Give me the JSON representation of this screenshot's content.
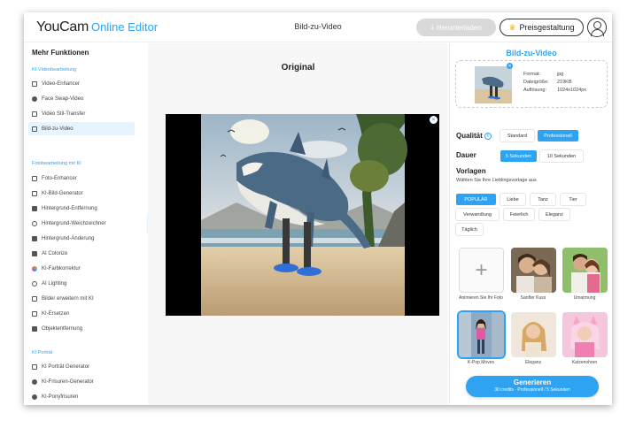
{
  "header": {
    "logo_brand": "YouCam",
    "logo_sub": "Online Editor",
    "page_title": "Bild-zu-Video",
    "download_label": "Herunterladen",
    "pricing_label": "Preisgestaltung"
  },
  "sidebar": {
    "title": "Mehr Funktionen",
    "sections": [
      {
        "label": "KI-Videobearbeitung"
      },
      {
        "label": "Fotobearbeitung mit KI"
      },
      {
        "label": "KI Porträt"
      }
    ],
    "items": [
      {
        "label": "Video-Enhancer"
      },
      {
        "label": "Face Swap-Video"
      },
      {
        "label": "Video Stil-Transfer"
      },
      {
        "label": "Bild-zu-Video",
        "active": true
      },
      {
        "label": "Foto-Enhancer"
      },
      {
        "label": "KI-Bild-Generator"
      },
      {
        "label": "Hintergrund-Entfernung"
      },
      {
        "label": "Hintergrund-Weichzeichner"
      },
      {
        "label": "Hintergrund-Änderung"
      },
      {
        "label": "AI Colorize"
      },
      {
        "label": "KI-Farbkorrektur"
      },
      {
        "label": "AI Lighting"
      },
      {
        "label": "Bilder erweitern mit KI"
      },
      {
        "label": "KI-Ersetzen"
      },
      {
        "label": "Objektentfernung"
      },
      {
        "label": "KI Porträt Generator"
      },
      {
        "label": "KI-Frisuren-Generator"
      },
      {
        "label": "KI-Ponyfrisuren"
      }
    ]
  },
  "main": {
    "title": "Original"
  },
  "panel": {
    "title": "Bild-zu-Video",
    "file": {
      "format_label": "Format:",
      "format_value": "jpg",
      "size_label": "Dateigröße:",
      "size_value": "219KB",
      "res_label": "Auflösung:",
      "res_value": "1024x1024px"
    },
    "quality_label": "Qualität",
    "quality_options": [
      "Standard",
      "Professionell"
    ],
    "quality_selected": "Professionell",
    "duration_label": "Dauer",
    "duration_options": [
      "5 Sekunden",
      "10 Sekunden"
    ],
    "duration_selected": "5 Sekunden",
    "templates_label": "Vorlagen",
    "templates_sub": "Wählen Sie Ihre Lieblingsvorlage aus",
    "filter_chips": [
      "POPULÄR",
      "Liebe",
      "Tanz",
      "Tier",
      "Verwandlung",
      "Feierlich",
      "Eleganz",
      "Täglich"
    ],
    "filter_selected": "POPULÄR",
    "templates": [
      {
        "label": "Animieren Sie Ihr Foto"
      },
      {
        "label": "Sanfter Kuss"
      },
      {
        "label": "Umarmung"
      },
      {
        "label": "K-Pop Moves"
      },
      {
        "label": "Eleganz"
      },
      {
        "label": "Katzenohren"
      }
    ],
    "generate_label": "Generieren",
    "generate_sub": "30 credits · Professionell / 5 Sekunden"
  },
  "colors": {
    "accent": "#2ea3f2",
    "disabled": "#d9d9d9"
  }
}
